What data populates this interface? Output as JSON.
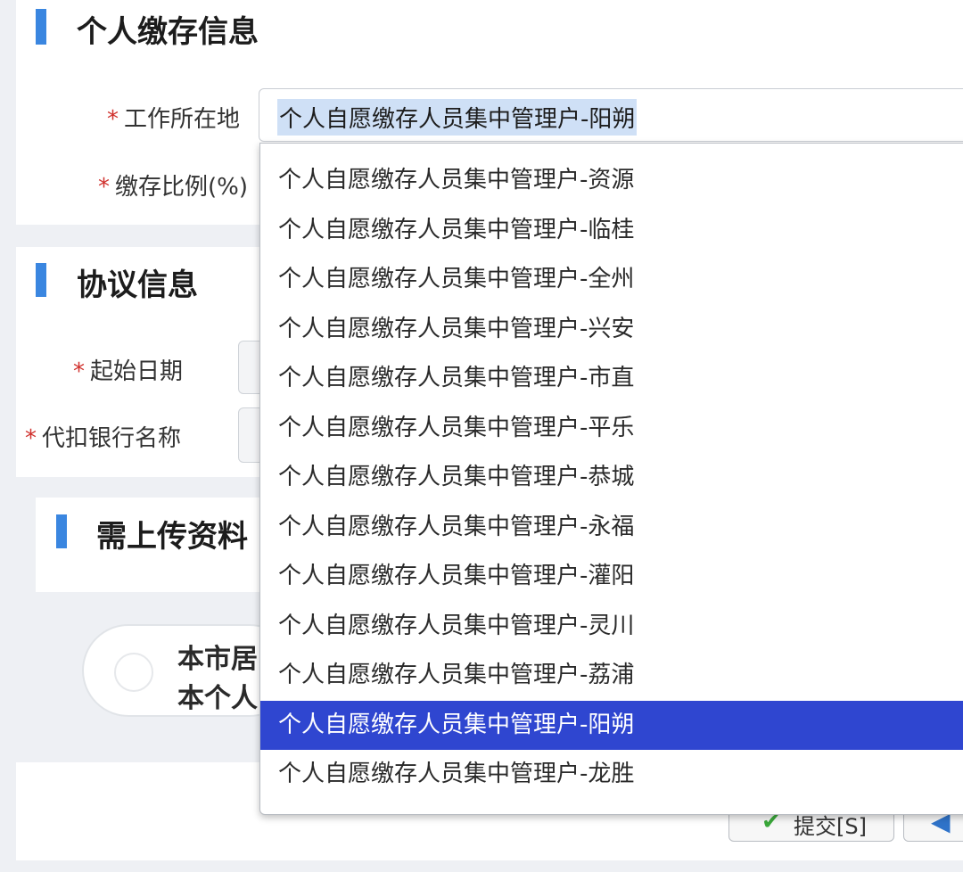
{
  "section_personal": {
    "title": "个人缴存信息",
    "work_location_label": "工作所在地",
    "work_location_value": "个人自愿缴存人员集中管理户-阳朔",
    "ratio_label": "缴存比例(%)"
  },
  "section_agreement": {
    "title": "协议信息",
    "start_date_label": "起始日期",
    "bank_label": "代扣银行名称"
  },
  "section_upload": {
    "title": "需上传资料",
    "option_line1": "本市居",
    "option_line2": "本个人"
  },
  "required_mark": "*",
  "dropdown": {
    "options": [
      "个人自愿缴存人员集中管理户-资源",
      "个人自愿缴存人员集中管理户-临桂",
      "个人自愿缴存人员集中管理户-全州",
      "个人自愿缴存人员集中管理户-兴安",
      "个人自愿缴存人员集中管理户-市直",
      "个人自愿缴存人员集中管理户-平乐",
      "个人自愿缴存人员集中管理户-恭城",
      "个人自愿缴存人员集中管理户-永福",
      "个人自愿缴存人员集中管理户-灌阳",
      "个人自愿缴存人员集中管理户-灵川",
      "个人自愿缴存人员集中管理户-荔浦",
      "个人自愿缴存人员集中管理户-阳朔",
      "个人自愿缴存人员集中管理户-龙胜"
    ],
    "selected": "个人自愿缴存人员集中管理户-阳朔"
  },
  "buttons": {
    "submit_label": "提交[S]"
  },
  "colors": {
    "accent_bar": "#3a86e0",
    "selected_option_bg": "#2f46d0",
    "required_mark": "#d0312d"
  }
}
